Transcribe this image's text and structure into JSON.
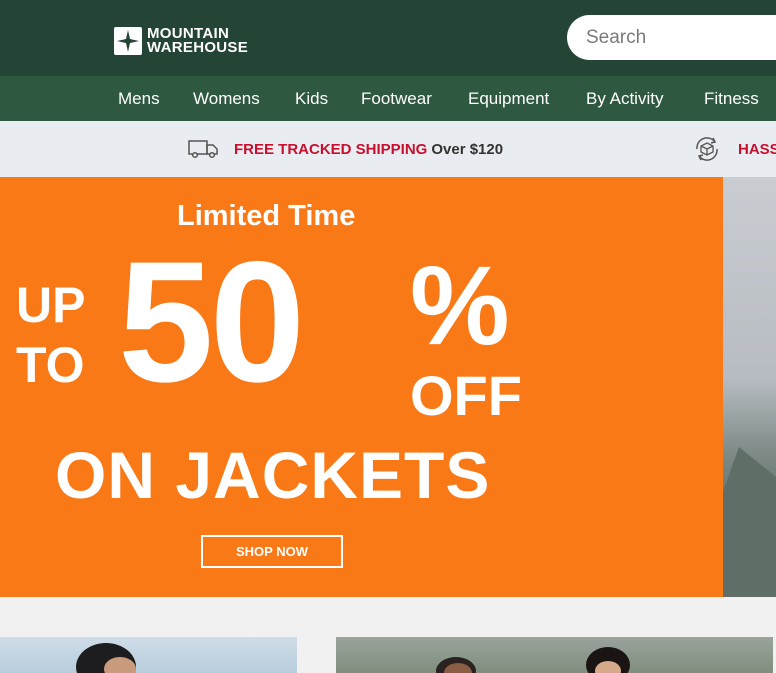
{
  "header": {
    "logo_line1": "MOUNTAIN",
    "logo_line2": "WAREHOUSE",
    "search_placeholder": "Search"
  },
  "nav": {
    "items": [
      "Mens",
      "Womens",
      "Kids",
      "Footwear",
      "Equipment",
      "By Activity",
      "Fitness"
    ]
  },
  "info_bar": {
    "shipping_highlight": "FREE TRACKED SHIPPING",
    "shipping_rest": "Over $120",
    "returns_highlight": "HASS"
  },
  "hero": {
    "limited": "Limited Time",
    "up": "UP",
    "to": "TO",
    "amount": "50",
    "percent": "%",
    "off": "OFF",
    "subject": "ON JACKETS",
    "cta": "SHOP NOW"
  },
  "colors": {
    "header_bg": "#244535",
    "nav_bg": "#2f5840",
    "hero_orange": "#f97917",
    "accent_red": "#c8102e",
    "info_bg": "#e9edf1"
  }
}
